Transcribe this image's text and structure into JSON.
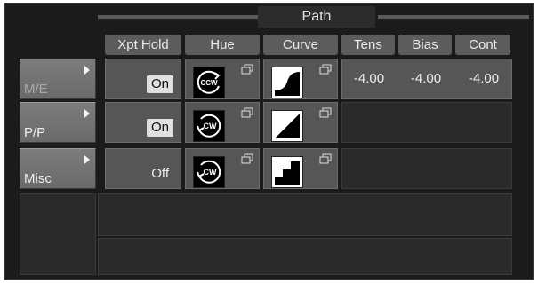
{
  "title": "Path",
  "headers": {
    "xpt_hold": "Xpt Hold",
    "hue": "Hue",
    "curve": "Curve",
    "tens": "Tens",
    "bias": "Bias",
    "cont": "Cont"
  },
  "rows": [
    {
      "label": "M/E",
      "xpt": "On",
      "hue_icon": "ccw-icon",
      "hue_text": "CCW",
      "curve_icon": "ease-curve-icon",
      "tens": "-4.00",
      "bias": "-4.00",
      "cont": "-4.00"
    },
    {
      "label": "P/P",
      "xpt": "On",
      "hue_icon": "cw-icon",
      "hue_text": "CW",
      "curve_icon": "linear-curve-icon"
    },
    {
      "label": "Misc",
      "xpt": "Off",
      "hue_icon": "cw-icon",
      "hue_text": "CW",
      "curve_icon": "step-curve-icon"
    }
  ]
}
